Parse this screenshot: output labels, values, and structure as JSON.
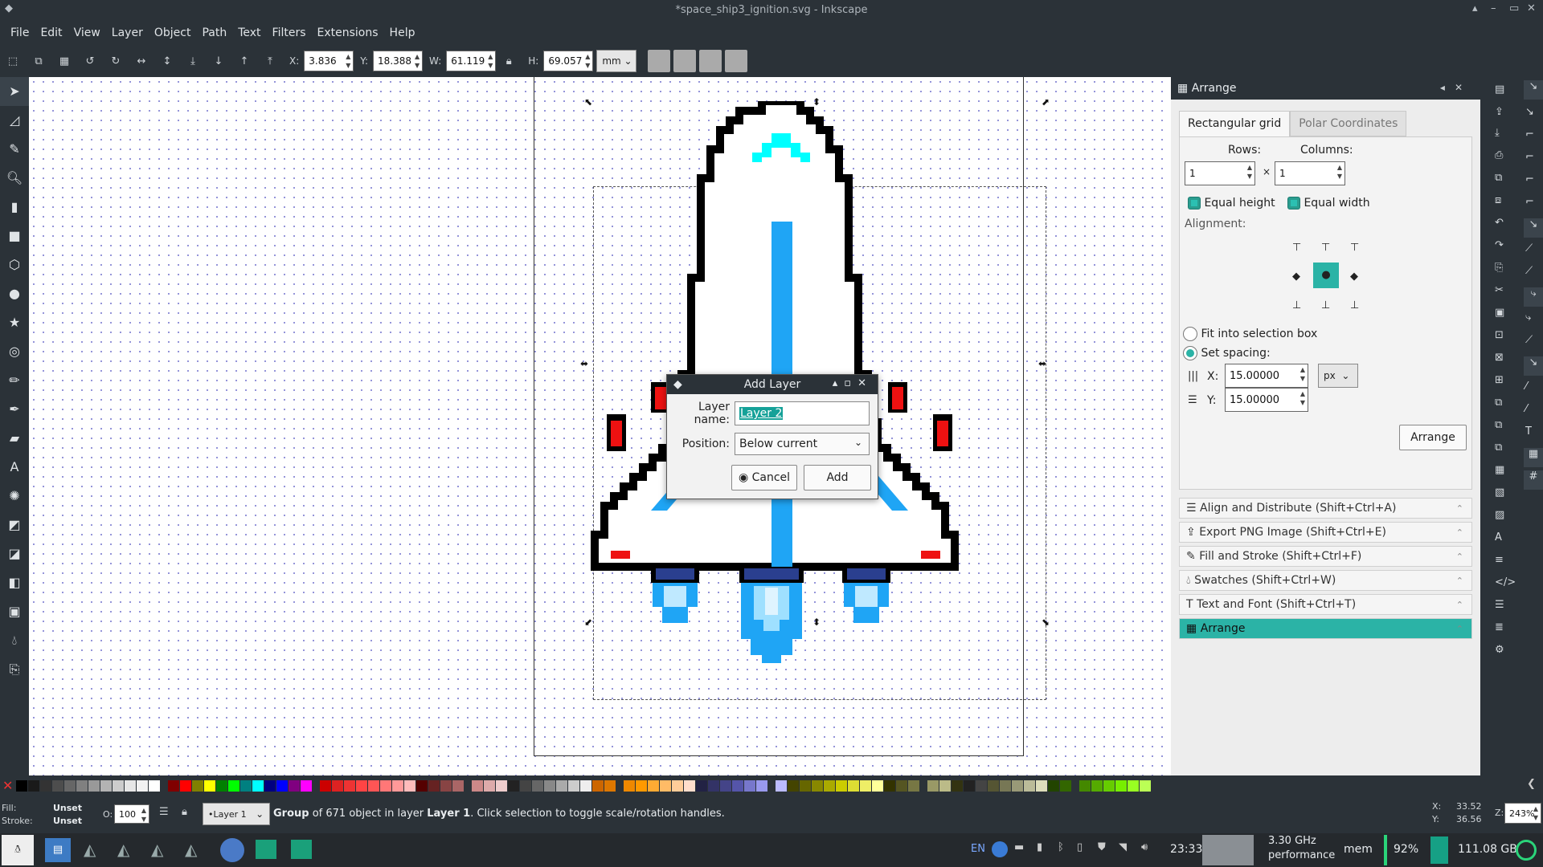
{
  "window": {
    "title": "*space_ship3_ignition.svg - Inkscape",
    "controls": [
      "▴",
      "–",
      "▭",
      "✕"
    ]
  },
  "menu": [
    "File",
    "Edit",
    "View",
    "Layer",
    "Object",
    "Path",
    "Text",
    "Filters",
    "Extensions",
    "Help"
  ],
  "toolbar": {
    "x_label": "X:",
    "x": "3.836",
    "y_label": "Y:",
    "y": "18.388",
    "w_label": "W:",
    "w": "61.119",
    "h_label": "H:",
    "h": "69.057",
    "unit": "mm"
  },
  "dialog": {
    "title": "Add Layer",
    "name_label": "Layer name:",
    "name_value": "Layer 2",
    "position_label": "Position:",
    "position_value": "Below current",
    "cancel": "Cancel",
    "add": "Add"
  },
  "panel": {
    "title": "Arrange",
    "tab1": "Rectangular grid",
    "tab2": "Polar Coordinates",
    "rows_label": "Rows:",
    "rows": "1",
    "cols_label": "Columns:",
    "cols": "1",
    "times": "×",
    "eq_height": "Equal height",
    "eq_width": "Equal width",
    "alignment": "Alignment:",
    "fit": "Fit into selection box",
    "set_spacing": "Set spacing:",
    "sx_label": "X:",
    "sx": "15.00000",
    "sy_label": "Y:",
    "sy": "15.00000",
    "sunit": "px",
    "arrange_btn": "Arrange",
    "expanders": [
      "Align and Distribute (Shift+Ctrl+A)",
      "Export PNG Image (Shift+Ctrl+E)",
      "Fill and Stroke (Shift+Ctrl+F)",
      "Swatches (Shift+Ctrl+W)",
      "Text and Font (Shift+Ctrl+T)",
      "Arrange"
    ]
  },
  "status": {
    "fill_label": "Fill:",
    "fill": "Unset",
    "stroke_label": "Stroke:",
    "stroke": "Unset",
    "opacity_label": "O:",
    "opacity": "100",
    "layer": "•Layer 1",
    "msg_b1": "Group",
    "msg_1": " of 671 object in layer ",
    "msg_b2": "Layer 1",
    "msg_2": ". Click selection to toggle scale/rotation handles.",
    "cx_label": "X:",
    "cx": "33.52",
    "cy_label": "Y:",
    "cy": "36.56",
    "zoom_label": "Z:",
    "zoom": "243%"
  },
  "taskbar": {
    "lang": "EN",
    "time": "23:33",
    "cpu": "3.30 GHz",
    "cpu_mode": "performance",
    "mem": "mem",
    "battery": "92%",
    "disk": "111.08 GB"
  }
}
